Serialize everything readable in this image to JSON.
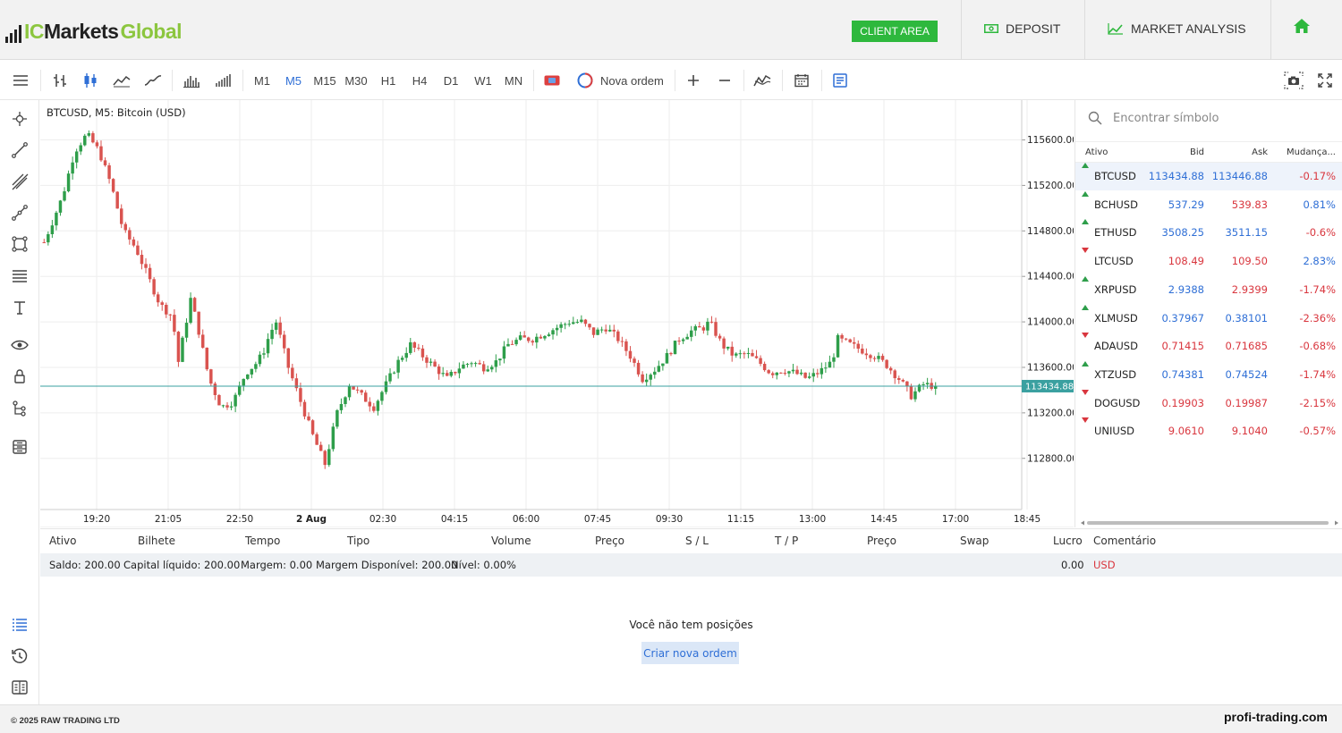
{
  "header": {
    "logo": {
      "ic": "IC",
      "markets": "Markets",
      "global": "Global"
    },
    "client_area": "CLIENT AREA",
    "deposit": "DEPOSIT",
    "market_analysis": "MARKET ANALYSIS"
  },
  "toolbar": {
    "timeframes": [
      "M1",
      "M5",
      "M15",
      "M30",
      "H1",
      "H4",
      "D1",
      "W1",
      "MN"
    ],
    "active_timeframe": "M5",
    "new_order": "Nova ordem"
  },
  "chart": {
    "title": "BTCUSD, M5: Bitcoin (USD)",
    "current_price": "113434.88"
  },
  "chart_data": {
    "type": "candlestick",
    "title": "BTCUSD, M5: Bitcoin (USD)",
    "y_tick_labels": [
      "115600.00",
      "115200.00",
      "114800.00",
      "114400.00",
      "114000.00",
      "113600.00",
      "113200.00",
      "112800.00"
    ],
    "y_ticks": [
      115600,
      115200,
      114800,
      114400,
      114000,
      113600,
      113200,
      112800
    ],
    "ylim": [
      112350,
      115950
    ],
    "x_tick_labels": [
      "19:20",
      "21:05",
      "22:50",
      "2 Aug",
      "02:30",
      "04:15",
      "06:00",
      "07:45",
      "09:30",
      "11:15",
      "13:00",
      "14:45",
      "17:00",
      "18:45"
    ],
    "current_price": 113434.88,
    "grid": true,
    "close_path": [
      [
        0,
        114700
      ],
      [
        3,
        115100
      ],
      [
        5,
        115500
      ],
      [
        7,
        115650
      ],
      [
        9,
        115500
      ],
      [
        11,
        115200
      ],
      [
        13,
        114800
      ],
      [
        15,
        114650
      ],
      [
        17,
        114400
      ],
      [
        19,
        114150
      ],
      [
        21,
        114050
      ],
      [
        22,
        113650
      ],
      [
        24,
        114200
      ],
      [
        25,
        114000
      ],
      [
        27,
        113500
      ],
      [
        29,
        113250
      ],
      [
        31,
        113300
      ],
      [
        33,
        113550
      ],
      [
        35,
        113650
      ],
      [
        36,
        113750
      ],
      [
        37,
        113900
      ],
      [
        38,
        114000
      ],
      [
        40,
        113600
      ],
      [
        42,
        113300
      ],
      [
        44,
        113000
      ],
      [
        46,
        112750
      ],
      [
        48,
        113200
      ],
      [
        50,
        113450
      ],
      [
        52,
        113350
      ],
      [
        54,
        113250
      ],
      [
        56,
        113450
      ],
      [
        58,
        113650
      ],
      [
        60,
        113800
      ],
      [
        62,
        113700
      ],
      [
        64,
        113600
      ],
      [
        66,
        113500
      ],
      [
        68,
        113600
      ],
      [
        70,
        113650
      ],
      [
        72,
        113600
      ],
      [
        74,
        113650
      ],
      [
        76,
        113800
      ],
      [
        78,
        113850
      ],
      [
        80,
        113850
      ],
      [
        82,
        113900
      ],
      [
        84,
        113950
      ],
      [
        86,
        114000
      ],
      [
        88,
        114000
      ],
      [
        90,
        113900
      ],
      [
        92,
        113950
      ],
      [
        94,
        113850
      ],
      [
        96,
        113700
      ],
      [
        98,
        113500
      ],
      [
        100,
        113580
      ],
      [
        102,
        113700
      ],
      [
        104,
        113850
      ],
      [
        106,
        113920
      ],
      [
        108,
        113950
      ],
      [
        109,
        114000
      ],
      [
        111,
        113800
      ],
      [
        113,
        113700
      ],
      [
        115,
        113720
      ],
      [
        117,
        113650
      ],
      [
        119,
        113550
      ],
      [
        121,
        113580
      ],
      [
        123,
        113550
      ],
      [
        125,
        113500
      ],
      [
        127,
        113560
      ],
      [
        129,
        113650
      ],
      [
        130,
        113850
      ],
      [
        132,
        113800
      ],
      [
        134,
        113750
      ],
      [
        136,
        113700
      ],
      [
        138,
        113620
      ],
      [
        140,
        113500
      ],
      [
        142,
        113350
      ],
      [
        144,
        113450
      ],
      [
        146,
        113434.88
      ]
    ]
  },
  "watchlist": {
    "search_placeholder": "Encontrar símbolo",
    "columns": [
      "Ativo",
      "Bid",
      "Ask",
      "Mudança..."
    ],
    "rows": [
      {
        "symbol": "BTCUSD",
        "bid": "113434.88",
        "ask": "113446.88",
        "change": "-0.17%",
        "dir": "up",
        "bid_color": "blue",
        "ask_color": "blue",
        "change_color": "red",
        "selected": true
      },
      {
        "symbol": "BCHUSD",
        "bid": "537.29",
        "ask": "539.83",
        "change": "0.81%",
        "dir": "up",
        "bid_color": "blue",
        "ask_color": "red",
        "change_color": "blue"
      },
      {
        "symbol": "ETHUSD",
        "bid": "3508.25",
        "ask": "3511.15",
        "change": "-0.6%",
        "dir": "up",
        "bid_color": "blue",
        "ask_color": "blue",
        "change_color": "red"
      },
      {
        "symbol": "LTCUSD",
        "bid": "108.49",
        "ask": "109.50",
        "change": "2.83%",
        "dir": "down",
        "bid_color": "red",
        "ask_color": "red",
        "change_color": "blue"
      },
      {
        "symbol": "XRPUSD",
        "bid": "2.9388",
        "ask": "2.9399",
        "change": "-1.74%",
        "dir": "up",
        "bid_color": "blue",
        "ask_color": "red",
        "change_color": "red"
      },
      {
        "symbol": "XLMUSD",
        "bid": "0.37967",
        "ask": "0.38101",
        "change": "-2.36%",
        "dir": "up",
        "bid_color": "blue",
        "ask_color": "blue",
        "change_color": "red"
      },
      {
        "symbol": "ADAUSD",
        "bid": "0.71415",
        "ask": "0.71685",
        "change": "-0.68%",
        "dir": "down",
        "bid_color": "red",
        "ask_color": "red",
        "change_color": "red"
      },
      {
        "symbol": "XTZUSD",
        "bid": "0.74381",
        "ask": "0.74524",
        "change": "-1.74%",
        "dir": "up",
        "bid_color": "blue",
        "ask_color": "blue",
        "change_color": "red"
      },
      {
        "symbol": "DOGUSD",
        "bid": "0.19903",
        "ask": "0.19987",
        "change": "-2.15%",
        "dir": "down",
        "bid_color": "red",
        "ask_color": "red",
        "change_color": "red"
      },
      {
        "symbol": "UNIUSD",
        "bid": "9.0610",
        "ask": "9.1040",
        "change": "-0.57%",
        "dir": "down",
        "bid_color": "red",
        "ask_color": "red",
        "change_color": "red"
      }
    ]
  },
  "positions": {
    "columns": [
      "Ativo",
      "Bilhete",
      "Tempo",
      "Tipo",
      "Volume",
      "Preço",
      "S / L",
      "T / P",
      "Preço",
      "Swap",
      "Lucro",
      "Comentário"
    ],
    "summary": {
      "saldo": "Saldo: 200.00",
      "capital": "Capital líquido: 200.00",
      "margem": "Margem: 0.00",
      "margem_disp": "Margem Disponível: 200.00",
      "nivel": "Nível: 0.00%",
      "profit": "0.00",
      "currency": "USD"
    },
    "empty_text": "Você não tem posições",
    "new_order_button": "Criar nova ordem"
  },
  "footer": {
    "copyright": "© 2025 RAW TRADING LTD",
    "watermark": "profi-trading.com"
  },
  "colors": {
    "accent_green": "#2eb83d",
    "logo_green": "#8cc63f",
    "blue": "#2f6fd6",
    "red": "#d9363e",
    "candle_up": "#2e9e4a",
    "candle_down": "#d9534f",
    "price_line": "#3aa0a0"
  }
}
